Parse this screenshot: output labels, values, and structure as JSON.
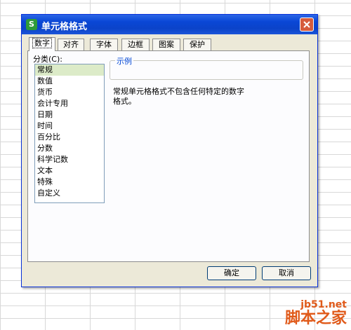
{
  "dialog": {
    "title": "单元格格式",
    "app_icon_letter": "S"
  },
  "tabs": [
    {
      "label": "数字",
      "active": true
    },
    {
      "label": "对齐",
      "active": false
    },
    {
      "label": "字体",
      "active": false
    },
    {
      "label": "边框",
      "active": false
    },
    {
      "label": "图案",
      "active": false
    },
    {
      "label": "保护",
      "active": false
    }
  ],
  "category": {
    "label": "分类(C):",
    "selected": "常规",
    "items": [
      "常规",
      "数值",
      "货币",
      "会计专用",
      "日期",
      "时间",
      "百分比",
      "分数",
      "科学记数",
      "文本",
      "特殊",
      "自定义"
    ]
  },
  "example": {
    "legend": "示例"
  },
  "description": {
    "line1": "常规单元格格式不包含任何特定的数字",
    "line2": "格式。"
  },
  "buttons": {
    "ok": "确定",
    "cancel": "取消"
  },
  "watermark": {
    "url": "jb51.net",
    "name": "脚本之家"
  },
  "colors": {
    "titlebar": "#0b43c9",
    "dialog_bg": "#ece9d8",
    "selected_item": "#dcebc8",
    "watermark": "#e05a1a"
  }
}
